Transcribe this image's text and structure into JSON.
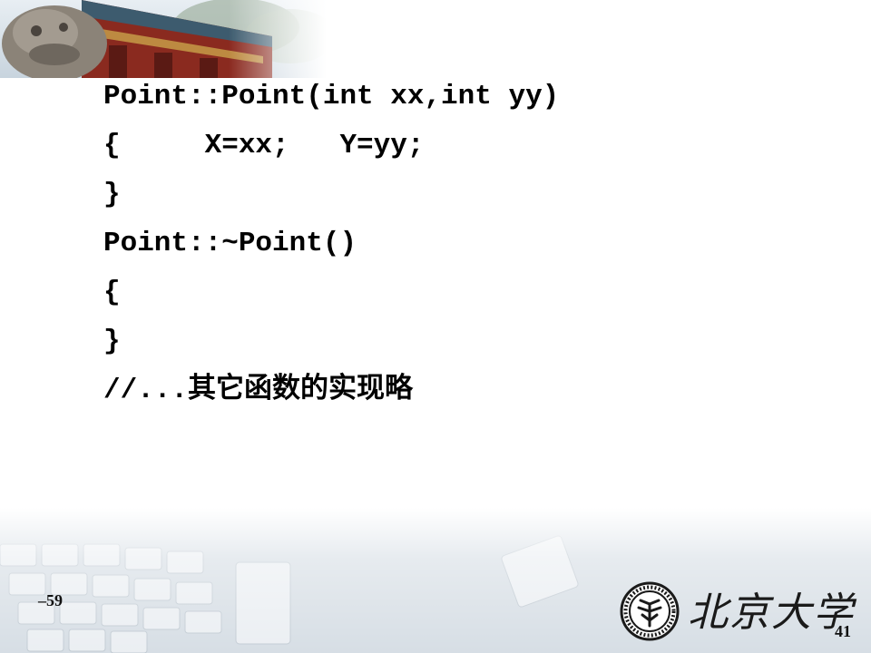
{
  "code_lines": [
    "Point::Point(int xx,int yy)",
    "{     X=xx;   Y=yy;",
    "}",
    "Point::~Point()",
    "{",
    "}",
    "//...其它函数的实现略"
  ],
  "footer": {
    "left_number": "–59",
    "page_number": "41",
    "logo_text": "北京大学"
  },
  "colors": {
    "banner_roof": "#7a1f17",
    "banner_sky": "#d9e4ee",
    "footer_tint": "#c9d3dc"
  }
}
